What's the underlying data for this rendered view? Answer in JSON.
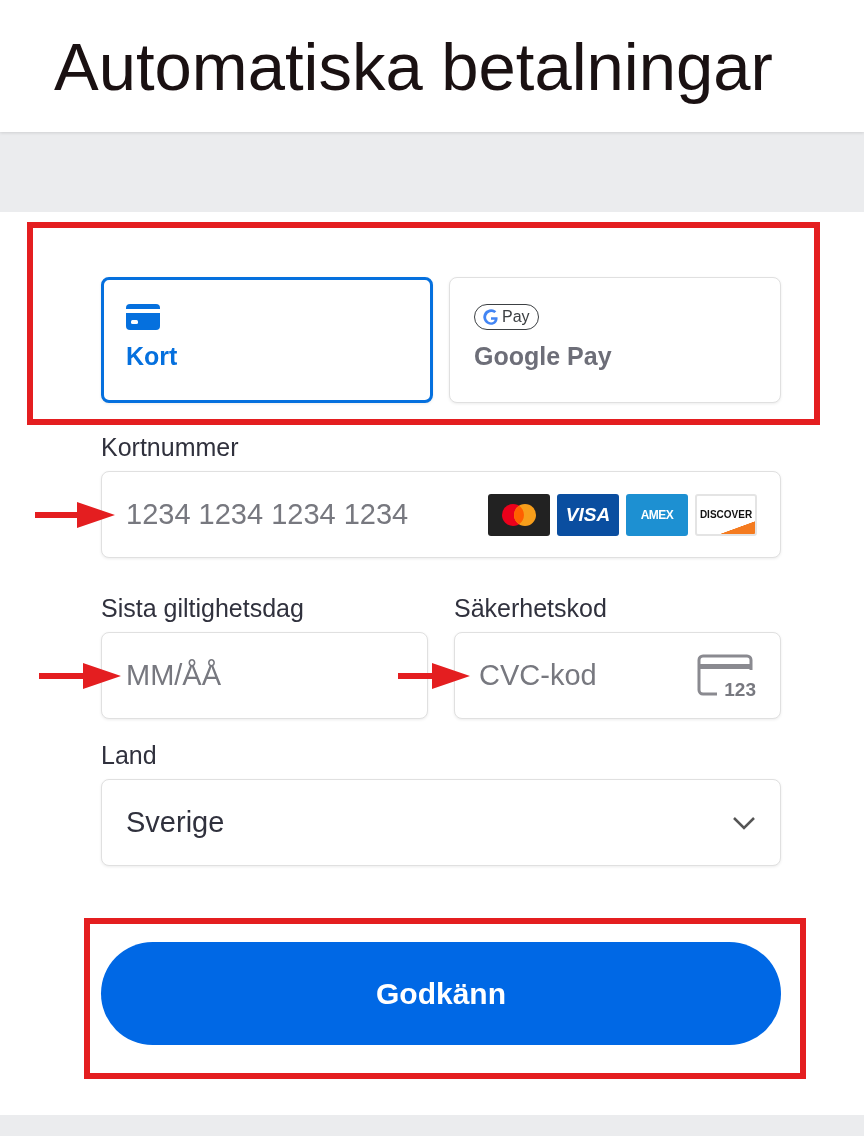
{
  "header": {
    "title": "Automatiska betalningar"
  },
  "payment_tabs": {
    "highlighted": true,
    "tabs": [
      {
        "kind": "card",
        "label": "Kort",
        "selected": true
      },
      {
        "kind": "gpay",
        "label": "Google Pay",
        "badge": "Pay",
        "selected": false
      }
    ]
  },
  "card_number": {
    "label": "Kortnummer",
    "placeholder": "1234 1234 1234 1234",
    "arrow": true,
    "brands": [
      {
        "kind": "mastercard"
      },
      {
        "kind": "visa",
        "text": "VISA"
      },
      {
        "kind": "amex",
        "text": "AMEX"
      },
      {
        "kind": "discover",
        "text": "DISCOVER"
      }
    ]
  },
  "expiry": {
    "label": "Sista giltighetsdag",
    "placeholder": "MM/ÅÅ",
    "arrow": true
  },
  "security_code": {
    "label": "Säkerhetskod",
    "placeholder": "CVC-kod",
    "arrow": true,
    "icon_text": "123"
  },
  "country": {
    "label": "Land",
    "value": "Sverige"
  },
  "submit": {
    "label": "Godkänn",
    "highlighted": true
  }
}
